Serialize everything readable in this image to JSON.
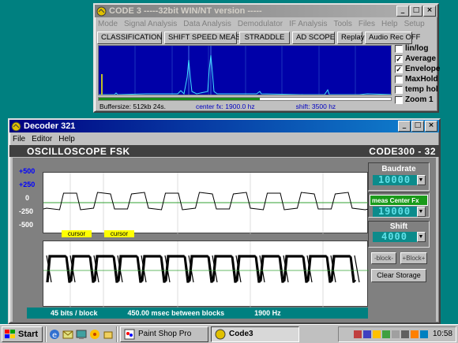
{
  "code3": {
    "title": "CODE 3 -----32bit WIN/NT version -----",
    "menu": [
      "Mode",
      "Signal Analysis",
      "Data Analysis",
      "Demodulator",
      "IF Analysis",
      "Tools",
      "Files",
      "Help",
      "Setup"
    ],
    "buttons": [
      "CLASSIFICATION",
      "SHIFT SPEED MEAS.",
      "STRADDLE",
      "AD SCOPE",
      "Replay",
      "Audio Rec OFF"
    ],
    "checkboxes": [
      {
        "label": "lin/log",
        "checked": false
      },
      {
        "label": "Average",
        "checked": true
      },
      {
        "label": "Envelope",
        "checked": true
      },
      {
        "label": "MaxHold",
        "checked": false
      },
      {
        "label": "temp hol",
        "checked": false
      },
      {
        "label": "Zoom 1",
        "checked": false
      }
    ],
    "buffersize": "Buffersize: 512kb  24s.",
    "center_fx": "center fx:   1900.0 hz",
    "shift": "shift: 3500 hz",
    "progress_fraction": 0.55
  },
  "decoder": {
    "title": "Decoder 321",
    "menu": [
      "File",
      "Editor",
      "Help"
    ],
    "scope_title": "OSCILLOSCOPE  FSK",
    "code_label": "CODE300 - 32",
    "y_labels": [
      "+500",
      "+250",
      "0",
      "-250",
      "-500"
    ],
    "cursor_labels": [
      "cursor",
      "cursor"
    ],
    "baudrate_label": "Baudrate",
    "baudrate_value": "10000",
    "center_select": "meas Center Fx",
    "center_value": "19000",
    "shift_label": "Shift",
    "shift_value": "4000",
    "block_prev": "-block-",
    "block_next": "+Block+",
    "clear_storage": "Clear Storage",
    "status": [
      "45 bits / block",
      "450.00 msec between blocks",
      "1900 Hz"
    ]
  },
  "taskbar": {
    "start": "Start",
    "tasks": [
      {
        "label": "Paint Shop Pro",
        "active": false
      },
      {
        "label": "Code3",
        "active": true
      }
    ],
    "clock": "10:58"
  },
  "colors": {
    "desktop": "#008080",
    "title_active": "#000080",
    "spectrum_bg": "#0000a8",
    "lcd": "#0c8b8b"
  }
}
